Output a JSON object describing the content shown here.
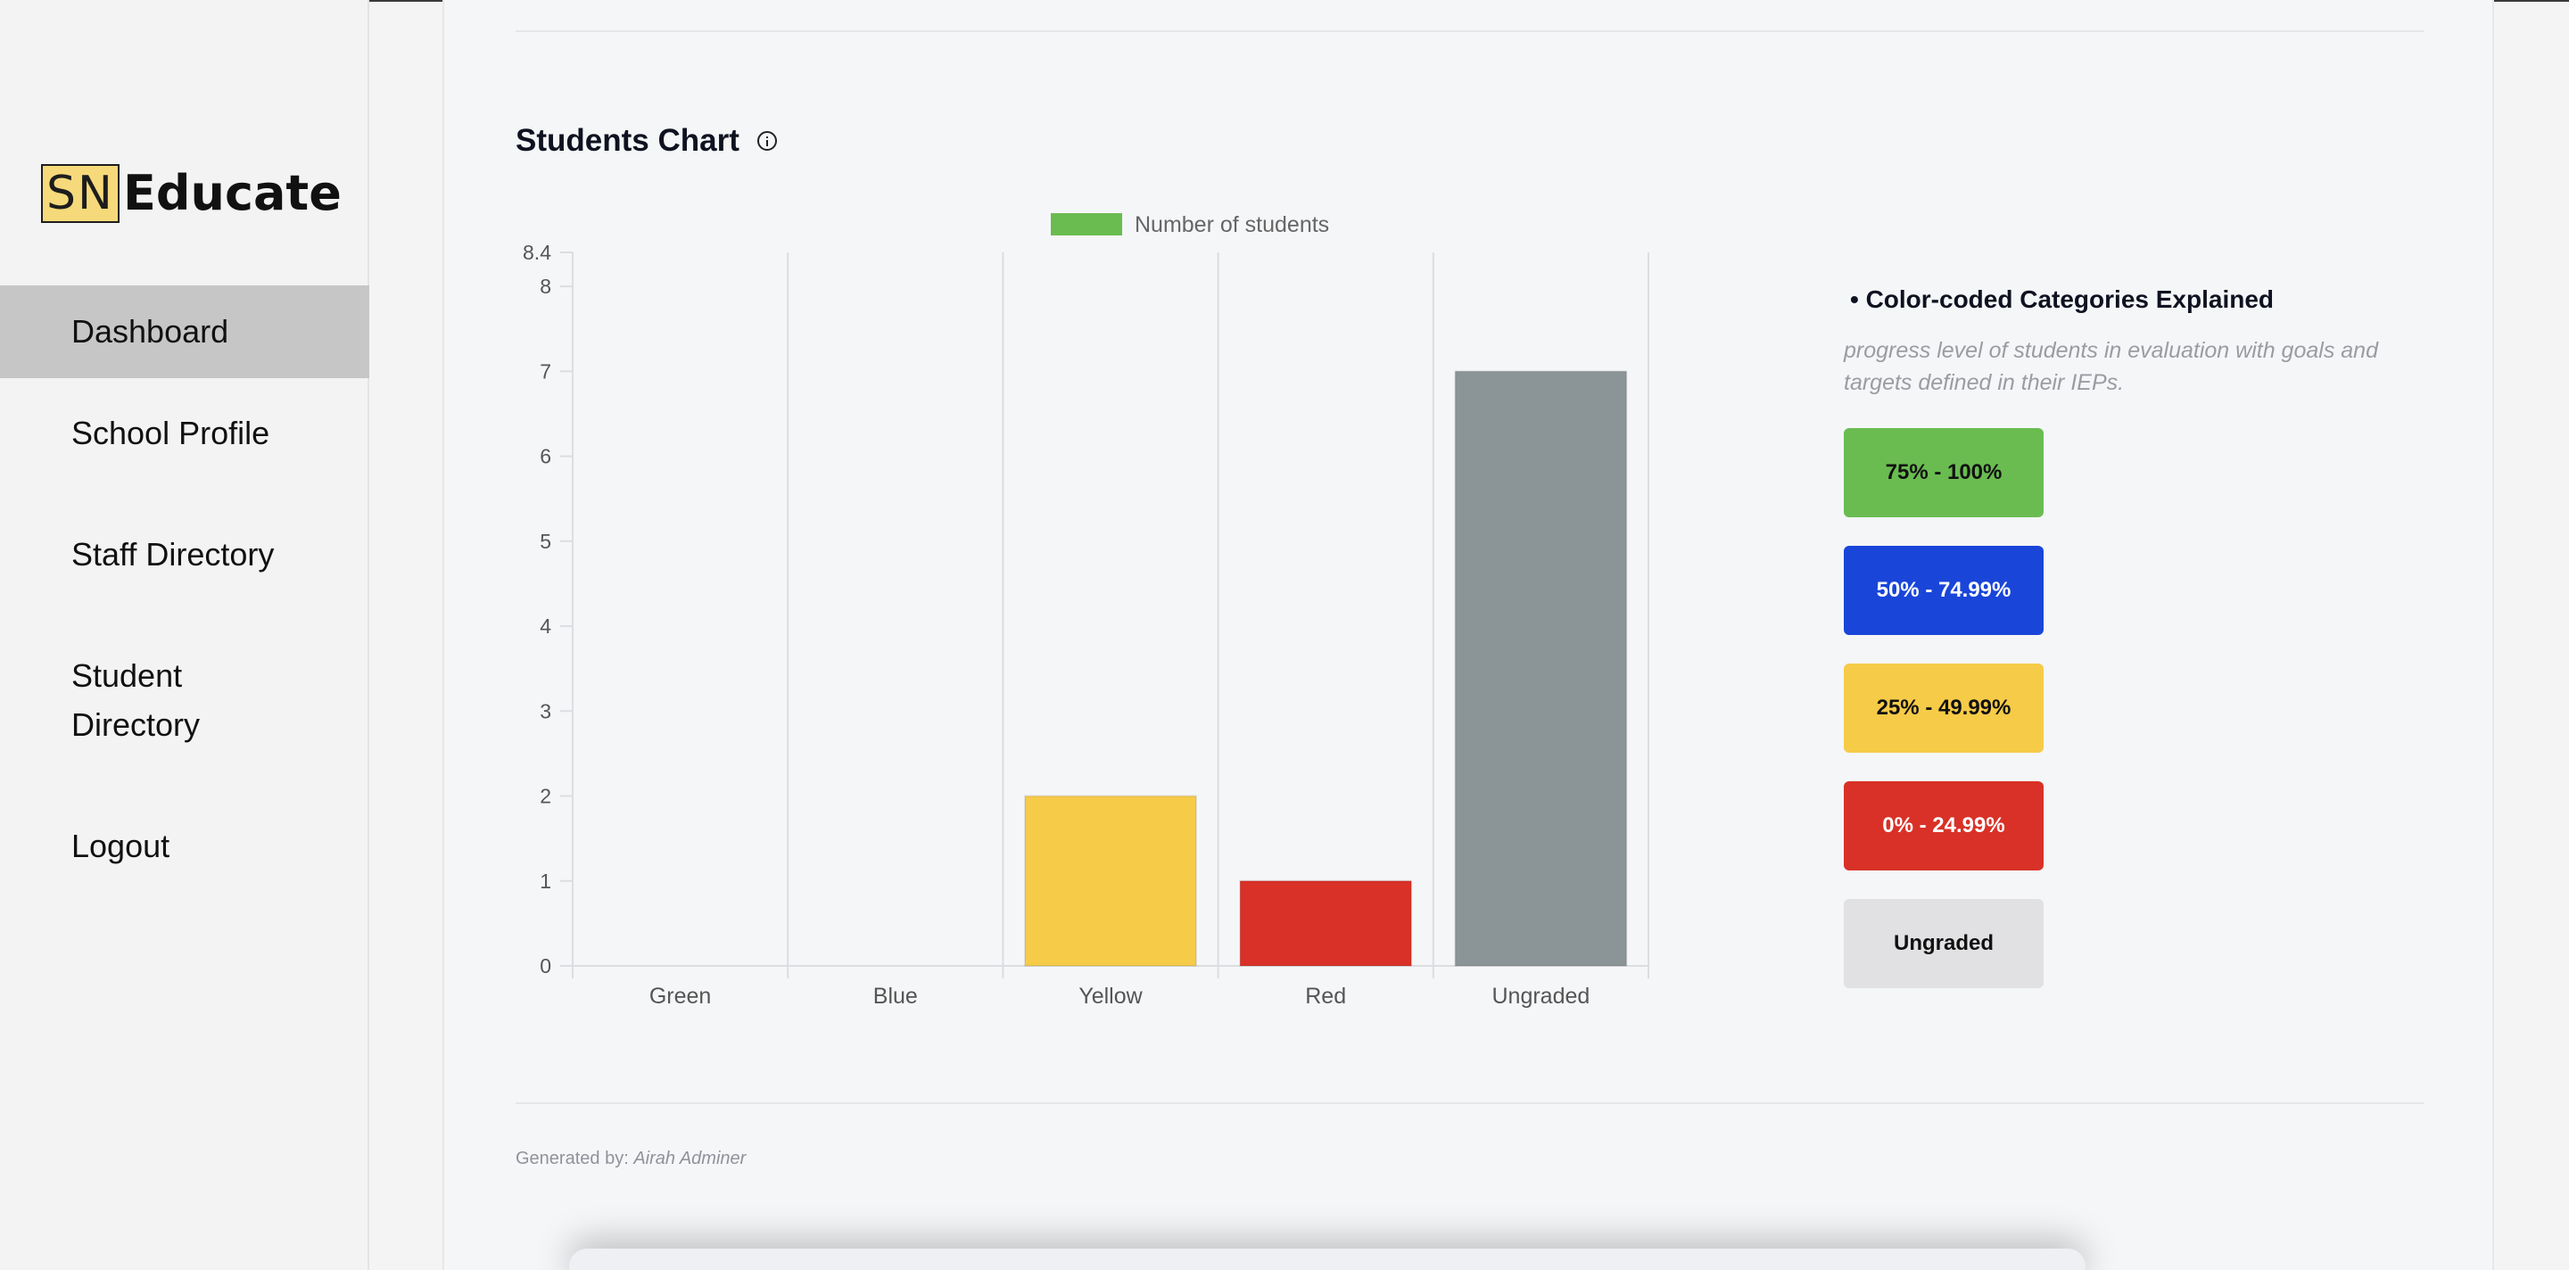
{
  "logo": {
    "mark": "SN",
    "name": "Educate"
  },
  "sidebar": {
    "items": [
      {
        "label": "Dashboard",
        "active": true
      },
      {
        "label": "School Profile"
      },
      {
        "label": "Staff Directory"
      },
      {
        "label": "Student Directory"
      },
      {
        "label": "Logout"
      }
    ]
  },
  "chart_section": {
    "title": "Students Chart",
    "info_icon": "info-circle-icon"
  },
  "chart_data": {
    "type": "bar",
    "title": "",
    "legend": [
      {
        "name": "Number of students",
        "color": "#6abc51"
      }
    ],
    "legend_position": "top",
    "categories": [
      "Green",
      "Blue",
      "Yellow",
      "Red",
      "Ungraded"
    ],
    "series": [
      {
        "name": "Number of students",
        "values": [
          0,
          0,
          2,
          1,
          7
        ],
        "colors": [
          "#6abc51",
          "#1945d9",
          "#f6cb48",
          "#d93127",
          "#8b9496"
        ]
      }
    ],
    "ylim": [
      0,
      8.4
    ],
    "yticks": [
      "0",
      "1",
      "2",
      "3",
      "4",
      "5",
      "6",
      "7",
      "8",
      "8.4"
    ],
    "grid": "vertical",
    "xlabel": "",
    "ylabel": ""
  },
  "legend_panel": {
    "title": "• Color-coded Categories Explained",
    "description": "progress level of students in evaluation with goals and targets defined in their IEPs.",
    "items": [
      {
        "label": "75% - 100%",
        "bg": "#6abc51",
        "color": "#111111"
      },
      {
        "label": "50% - 74.99%",
        "bg": "#1945d9",
        "color": "#ffffff"
      },
      {
        "label": "25% - 49.99%",
        "bg": "#f6cb48",
        "color": "#111111"
      },
      {
        "label": "0% - 24.99%",
        "bg": "#d93127",
        "color": "#ffffff"
      },
      {
        "label": "Ungraded",
        "bg": "#e1e1e3",
        "color": "#111111"
      }
    ]
  },
  "footer": {
    "generated_label": "Generated by:",
    "generated_by": "Airah Adminer"
  }
}
